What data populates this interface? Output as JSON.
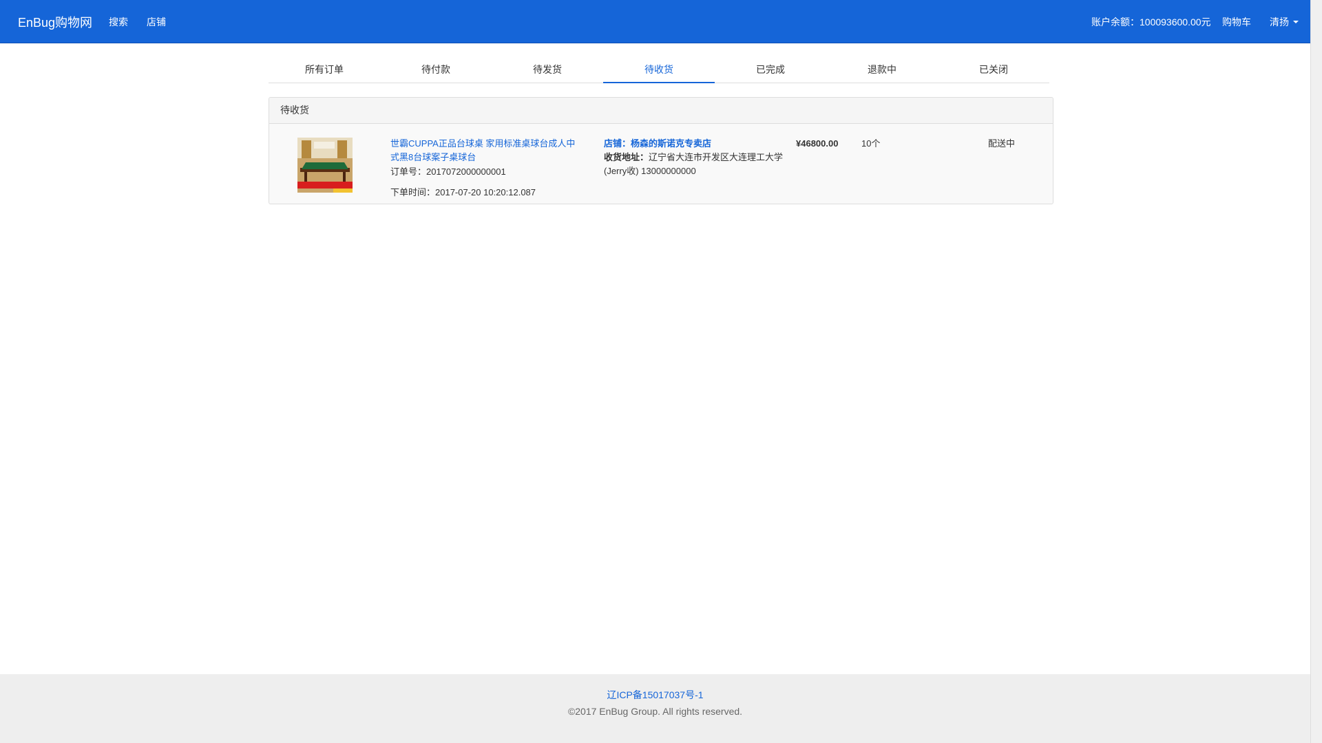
{
  "navbar": {
    "brand": "EnBug购物网",
    "links": [
      "搜索",
      "店铺"
    ],
    "balance": "账户余额：100093600.00元",
    "cart": "购物车",
    "user": "清扬"
  },
  "tabs": [
    "所有订单",
    "待付款",
    "待发货",
    "待收货",
    "已完成",
    "退款中",
    "已关闭"
  ],
  "active_tab_index": 3,
  "panel": {
    "heading": "待收货",
    "order": {
      "product_title": "世霸CUPPA正品台球桌 家用标准桌球台成人中式黑8台球案子桌球台",
      "order_no": "订单号：2017072000000001",
      "order_time": "下单时间：2017-07-20 10:20:12.087",
      "shop": "店铺：杨森的斯诺克专卖店",
      "address_label": "收货地址：",
      "address": "辽宁省大连市开发区大连理工大学(Jerry收) 13000000000",
      "price": "¥46800.00",
      "quantity": "10个",
      "status": "配送中",
      "thumb_banner": "4大优惠 超赞服务",
      "thumb_corner": "品质保障"
    }
  },
  "footer": {
    "icp": "辽ICP备15017037号-1",
    "copyright": "©2017 EnBug Group. All rights reserved."
  },
  "colors": {
    "primary": "#1565d8",
    "footer_bg": "#eeeeee"
  }
}
